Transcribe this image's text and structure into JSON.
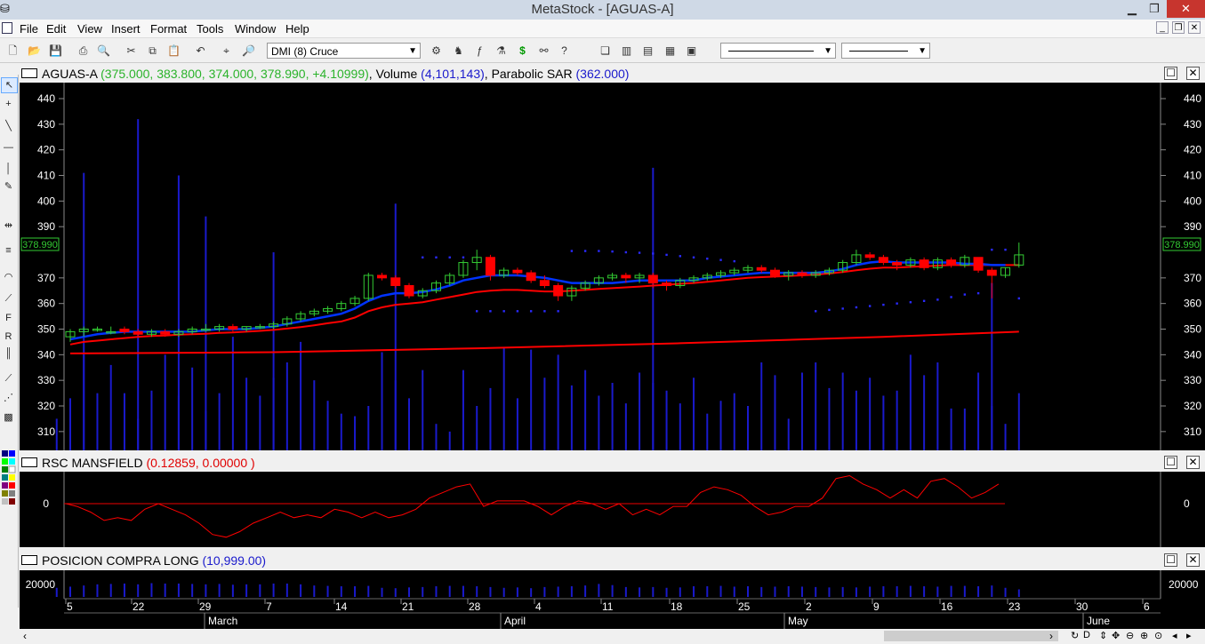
{
  "window": {
    "title": "MetaStock - [AGUAS-A]"
  },
  "menu": [
    "File",
    "Edit",
    "View",
    "Insert",
    "Format",
    "Tools",
    "Window",
    "Help"
  ],
  "toolbar": {
    "template_combo": "DMI (8) Cruce"
  },
  "price_panel": {
    "symbol": "AGUAS-A",
    "ohlc_text": "(375.000, 383.800, 374.000, 378.990, +4.10999)",
    "volume_label": "Volume",
    "volume_text": "(4,101,143)",
    "sar_label": "Parabolic SAR",
    "sar_text": "(362.000)",
    "last_price": "378.990",
    "y_ticks": [
      "440",
      "430",
      "420",
      "410",
      "400",
      "390",
      "370",
      "360",
      "350",
      "340",
      "330",
      "320",
      "310"
    ]
  },
  "rsc_panel": {
    "title": "RSC MANSFIELD",
    "values": "(0.12859, 0.00000 )",
    "y_tick": "0"
  },
  "pos_panel": {
    "title": "POSICION COMPRA LONG",
    "values": "(10,999.00)",
    "y_tick": "20000"
  },
  "x_axis": {
    "day_labels": [
      "5",
      "22",
      "29",
      "7",
      "14",
      "21",
      "28",
      "4",
      "11",
      "18",
      "25",
      "2",
      "9",
      "16",
      "23",
      "30",
      "6"
    ],
    "month_labels": [
      "March",
      "April",
      "May",
      "June"
    ]
  },
  "colors": {
    "up": "#33cc33",
    "down": "#ff0000",
    "ma_fast": "#0033ff",
    "ma_slow": "#ff0000",
    "volume": "#1a1acc",
    "sar": "#2a2aff",
    "label_green": "#2bb32b",
    "label_blue": "#1a1acc",
    "label_red": "#e00000"
  },
  "chart_data": {
    "type": "candlestick",
    "ylim": [
      305,
      445
    ],
    "candles": [
      [
        347,
        350,
        345,
        349
      ],
      [
        349,
        351,
        347,
        350
      ],
      [
        350,
        351,
        349,
        350
      ],
      [
        349,
        351,
        348,
        349
      ],
      [
        350,
        351,
        348,
        349
      ],
      [
        349,
        350,
        347,
        348
      ],
      [
        348,
        350,
        347,
        349
      ],
      [
        349,
        350,
        347,
        348
      ],
      [
        348,
        350,
        347,
        349
      ],
      [
        349,
        351,
        348,
        350
      ],
      [
        350,
        352,
        349,
        350
      ],
      [
        350,
        352,
        349,
        351
      ],
      [
        351,
        352,
        349,
        350
      ],
      [
        350,
        351,
        349,
        351
      ],
      [
        351,
        352,
        350,
        351
      ],
      [
        351,
        353,
        350,
        352
      ],
      [
        352,
        355,
        351,
        354
      ],
      [
        354,
        357,
        353,
        356
      ],
      [
        356,
        358,
        355,
        357
      ],
      [
        357,
        359,
        356,
        358
      ],
      [
        358,
        361,
        357,
        360
      ],
      [
        360,
        363,
        359,
        362
      ],
      [
        362,
        372,
        361,
        371
      ],
      [
        371,
        372,
        369,
        370
      ],
      [
        370,
        371,
        366,
        367
      ],
      [
        367,
        368,
        362,
        363
      ],
      [
        363,
        366,
        362,
        365
      ],
      [
        365,
        369,
        364,
        368
      ],
      [
        368,
        372,
        367,
        371
      ],
      [
        371,
        377,
        370,
        376
      ],
      [
        376,
        381,
        373,
        378
      ],
      [
        378,
        379,
        369,
        371
      ],
      [
        371,
        374,
        370,
        373
      ],
      [
        373,
        374,
        371,
        372
      ],
      [
        372,
        373,
        368,
        369
      ],
      [
        369,
        371,
        366,
        367
      ],
      [
        367,
        368,
        361,
        363
      ],
      [
        363,
        367,
        361,
        366
      ],
      [
        366,
        369,
        365,
        368
      ],
      [
        368,
        371,
        367,
        370
      ],
      [
        370,
        372,
        369,
        371
      ],
      [
        371,
        372,
        368,
        370
      ],
      [
        370,
        372,
        368,
        371
      ],
      [
        371,
        372,
        366,
        368
      ],
      [
        368,
        369,
        365,
        367
      ],
      [
        367,
        370,
        366,
        369
      ],
      [
        369,
        371,
        368,
        370
      ],
      [
        370,
        372,
        369,
        371
      ],
      [
        371,
        373,
        370,
        372
      ],
      [
        372,
        374,
        371,
        373
      ],
      [
        373,
        375,
        372,
        374
      ],
      [
        374,
        375,
        372,
        373
      ],
      [
        373,
        374,
        370,
        371
      ],
      [
        371,
        373,
        369,
        372
      ],
      [
        372,
        373,
        370,
        371
      ],
      [
        371,
        373,
        370,
        372
      ],
      [
        372,
        374,
        371,
        373
      ],
      [
        373,
        377,
        372,
        376
      ],
      [
        376,
        381,
        375,
        379
      ],
      [
        379,
        380,
        377,
        378
      ],
      [
        378,
        379,
        375,
        376
      ],
      [
        376,
        377,
        373,
        375
      ],
      [
        375,
        378,
        374,
        377
      ],
      [
        377,
        378,
        373,
        374
      ],
      [
        374,
        378,
        373,
        377
      ],
      [
        377,
        378,
        374,
        375
      ],
      [
        375,
        379,
        374,
        378
      ],
      [
        378,
        378,
        372,
        373
      ],
      [
        373,
        374,
        362,
        371
      ],
      [
        371,
        374,
        370,
        374
      ],
      [
        375,
        383.8,
        374,
        378.99
      ]
    ],
    "volume": [
      [
        -1,
        315
      ],
      [
        0,
        323
      ],
      [
        1,
        341
      ],
      [
        2,
        325
      ],
      [
        3,
        336
      ],
      [
        4,
        325
      ],
      [
        5,
        315
      ],
      [
        6,
        326
      ],
      [
        7,
        340
      ],
      [
        8,
        324
      ],
      [
        9,
        335
      ],
      [
        10,
        318
      ],
      [
        11,
        325
      ],
      [
        12,
        347
      ],
      [
        13,
        331
      ],
      [
        14,
        324
      ],
      [
        15,
        331
      ],
      [
        16,
        337
      ],
      [
        17,
        345
      ],
      [
        18,
        330
      ],
      [
        19,
        322
      ],
      [
        20,
        317
      ],
      [
        21,
        316
      ],
      [
        22,
        320
      ],
      [
        23,
        341
      ],
      [
        24,
        330
      ],
      [
        25,
        323
      ],
      [
        26,
        334
      ],
      [
        27,
        313
      ],
      [
        28,
        310
      ],
      [
        29,
        334
      ],
      [
        30,
        320
      ],
      [
        31,
        327
      ],
      [
        32,
        343
      ],
      [
        33,
        323
      ],
      [
        34,
        342
      ],
      [
        35,
        331
      ],
      [
        36,
        340
      ],
      [
        37,
        328
      ],
      [
        38,
        334
      ],
      [
        39,
        324
      ],
      [
        40,
        329
      ],
      [
        41,
        321
      ],
      [
        42,
        333
      ],
      [
        43,
        329
      ],
      [
        44,
        326
      ],
      [
        45,
        321
      ],
      [
        46,
        331
      ],
      [
        47,
        317
      ],
      [
        48,
        322
      ],
      [
        49,
        325
      ],
      [
        50,
        320
      ],
      [
        51,
        337
      ],
      [
        52,
        332
      ],
      [
        53,
        315
      ],
      [
        54,
        333
      ],
      [
        55,
        337
      ],
      [
        56,
        327
      ],
      [
        57,
        333
      ],
      [
        58,
        326
      ],
      [
        59,
        331
      ],
      [
        60,
        324
      ],
      [
        61,
        326
      ],
      [
        62,
        340
      ],
      [
        63,
        332
      ],
      [
        64,
        337
      ],
      [
        65,
        319
      ],
      [
        66,
        319
      ],
      [
        67,
        333
      ],
      [
        68,
        320
      ],
      [
        69,
        313
      ],
      [
        70,
        325
      ]
    ],
    "volume_spikes": [
      [
        1,
        411
      ],
      [
        5,
        432
      ],
      [
        8,
        410
      ],
      [
        10,
        394
      ],
      [
        15,
        380
      ],
      [
        24,
        399
      ],
      [
        43,
        413
      ],
      [
        68,
        368
      ]
    ],
    "ma_fast": [
      346,
      347,
      348,
      348.5,
      349,
      349,
      349,
      349,
      349,
      349,
      349.5,
      350,
      350,
      350,
      350.5,
      351,
      352,
      353,
      354,
      355,
      356,
      358,
      361,
      363,
      364,
      364,
      364.5,
      365.5,
      367,
      369,
      370,
      371,
      371,
      371,
      370.5,
      370,
      369,
      368,
      368,
      368,
      368,
      368.5,
      369,
      369,
      369,
      369,
      369,
      370,
      370.5,
      371,
      371.5,
      372,
      372,
      372,
      372,
      372,
      372.5,
      373.5,
      375,
      376,
      376.5,
      376,
      376,
      376,
      376,
      376,
      375.5,
      375.5,
      375,
      375
    ],
    "ma_mid": [
      344,
      345,
      345.5,
      346,
      346.5,
      347,
      347.3,
      347.5,
      347.8,
      348,
      348.2,
      348.5,
      348.7,
      349,
      349.3,
      349.7,
      350.2,
      350.8,
      351.5,
      352.3,
      353,
      354.5,
      357,
      358.5,
      359.5,
      360,
      360.5,
      361.5,
      362.5,
      363.5,
      364.5,
      365,
      365.3,
      365.3,
      365,
      364.7,
      364.7,
      365,
      365.3,
      365.7,
      366,
      366.3,
      366.6,
      367,
      367.3,
      367.7,
      368,
      368.5,
      369,
      369.5,
      370,
      370.3,
      370.5,
      370.7,
      371,
      371.3,
      371.7,
      372.3,
      373,
      373.6,
      374,
      374,
      374.3,
      374.5,
      374.8,
      375,
      375,
      375,
      375,
      375,
      375
    ],
    "ma_slow": [
      [
        0,
        340.5
      ],
      [
        15,
        341
      ],
      [
        30,
        342.5
      ],
      [
        45,
        344.5
      ],
      [
        60,
        347
      ],
      [
        70,
        349
      ]
    ],
    "sar": [
      [
        26,
        378
      ],
      [
        27,
        378
      ],
      [
        28,
        378
      ],
      [
        29,
        378
      ],
      [
        30,
        357
      ],
      [
        31,
        357
      ],
      [
        32,
        357
      ],
      [
        33,
        357
      ],
      [
        34,
        357
      ],
      [
        35,
        357
      ],
      [
        36,
        357
      ],
      [
        37,
        380.5
      ],
      [
        38,
        380.5
      ],
      [
        39,
        380.5
      ],
      [
        40,
        380.3
      ],
      [
        41,
        380
      ],
      [
        42,
        379.8
      ],
      [
        43,
        379.5
      ],
      [
        44,
        379
      ],
      [
        45,
        378.5
      ],
      [
        46,
        378
      ],
      [
        47,
        377.5
      ],
      [
        48,
        377
      ],
      [
        49,
        376.5
      ],
      [
        55,
        357
      ],
      [
        56,
        357.5
      ],
      [
        57,
        358
      ],
      [
        58,
        358.5
      ],
      [
        59,
        359
      ],
      [
        60,
        359.5
      ],
      [
        61,
        360
      ],
      [
        62,
        360.5
      ],
      [
        63,
        361
      ],
      [
        64,
        361.5
      ],
      [
        65,
        362.5
      ],
      [
        66,
        363.5
      ],
      [
        67,
        364
      ],
      [
        68,
        381
      ],
      [
        69,
        381
      ],
      [
        70,
        362
      ]
    ],
    "rsc": [
      [
        -0.3,
        0
      ],
      [
        0.5,
        -0.5
      ],
      [
        1.5,
        -1.5
      ],
      [
        2.5,
        -3
      ],
      [
        3.5,
        -2.5
      ],
      [
        4.5,
        -3
      ],
      [
        5.5,
        -1
      ],
      [
        6.5,
        0
      ],
      [
        7.5,
        -1
      ],
      [
        8.5,
        -2
      ],
      [
        9.5,
        -3.5
      ],
      [
        10.5,
        -5.5
      ],
      [
        11.5,
        -6
      ],
      [
        12.5,
        -5
      ],
      [
        13.5,
        -3.5
      ],
      [
        14.5,
        -2.5
      ],
      [
        15.5,
        -1.5
      ],
      [
        16.5,
        -2.5
      ],
      [
        17.5,
        -2
      ],
      [
        18.5,
        -2.5
      ],
      [
        19.5,
        -1
      ],
      [
        20.5,
        -1.5
      ],
      [
        21.5,
        -2.5
      ],
      [
        22.5,
        -1.5
      ],
      [
        23.5,
        -2.5
      ],
      [
        24.5,
        -2
      ],
      [
        25.5,
        -1
      ],
      [
        26.5,
        1
      ],
      [
        27.5,
        2
      ],
      [
        28.5,
        3
      ],
      [
        29.5,
        3.5
      ],
      [
        30.5,
        -0.5
      ],
      [
        31.5,
        0.5
      ],
      [
        32.5,
        0.5
      ],
      [
        33.5,
        0.5
      ],
      [
        34.5,
        -0.5
      ],
      [
        35.5,
        -2
      ],
      [
        36.5,
        -0.5
      ],
      [
        37.5,
        0.5
      ],
      [
        38.5,
        0
      ],
      [
        39.5,
        -1
      ],
      [
        40.5,
        0
      ],
      [
        41.5,
        -2
      ],
      [
        42.5,
        -1
      ],
      [
        43.5,
        -2
      ],
      [
        44.5,
        -0.5
      ],
      [
        45.5,
        -0.5
      ],
      [
        46.5,
        2
      ],
      [
        47.5,
        3
      ],
      [
        48.5,
        2.5
      ],
      [
        49.5,
        1.5
      ],
      [
        50.5,
        -0.5
      ],
      [
        51.5,
        -2
      ],
      [
        52.5,
        -1.5
      ],
      [
        53.5,
        -0.5
      ],
      [
        54.5,
        -0.5
      ],
      [
        55.5,
        1
      ],
      [
        56.5,
        4.5
      ],
      [
        57.5,
        5
      ],
      [
        58.5,
        3.5
      ],
      [
        59.5,
        2.5
      ],
      [
        60.5,
        1
      ],
      [
        61.5,
        2.5
      ],
      [
        62.5,
        1
      ],
      [
        63.5,
        4
      ],
      [
        64.5,
        4.5
      ],
      [
        65.5,
        3
      ],
      [
        66.5,
        1
      ],
      [
        67.5,
        2
      ],
      [
        68.5,
        3.5
      ]
    ],
    "pos_bars": [
      [
        -1,
        14000
      ],
      [
        0,
        15500
      ],
      [
        1,
        17000
      ],
      [
        2,
        18500
      ],
      [
        3,
        19000
      ],
      [
        4,
        19500
      ],
      [
        5,
        18500
      ],
      [
        6,
        20000
      ],
      [
        7,
        19500
      ],
      [
        8,
        19500
      ],
      [
        9,
        19000
      ],
      [
        10,
        18500
      ],
      [
        11,
        19000
      ],
      [
        12,
        18000
      ],
      [
        13,
        18500
      ],
      [
        14,
        18500
      ],
      [
        15,
        19500
      ],
      [
        16,
        19500
      ],
      [
        17,
        18500
      ],
      [
        18,
        17000
      ],
      [
        19,
        16500
      ],
      [
        20,
        16000
      ],
      [
        21,
        16000
      ],
      [
        22,
        16500
      ],
      [
        23,
        14000
      ],
      [
        24,
        13500
      ],
      [
        25,
        14500
      ],
      [
        26,
        15000
      ],
      [
        27,
        16000
      ],
      [
        28,
        16500
      ],
      [
        29,
        16500
      ],
      [
        30,
        16000
      ],
      [
        31,
        15000
      ],
      [
        32,
        14000
      ],
      [
        33,
        14500
      ],
      [
        34,
        13500
      ],
      [
        35,
        15000
      ],
      [
        36,
        15500
      ],
      [
        37,
        16000
      ],
      [
        38,
        17000
      ],
      [
        39,
        19000
      ],
      [
        40,
        17500
      ],
      [
        41,
        15000
      ],
      [
        42,
        14500
      ],
      [
        43,
        15000
      ],
      [
        44,
        14000
      ],
      [
        45,
        14500
      ],
      [
        46,
        16000
      ],
      [
        47,
        16000
      ],
      [
        48,
        16500
      ],
      [
        49,
        15500
      ],
      [
        50,
        16000
      ],
      [
        51,
        15000
      ],
      [
        52,
        15500
      ],
      [
        53,
        16000
      ],
      [
        54,
        15500
      ],
      [
        55,
        15000
      ],
      [
        56,
        14500
      ],
      [
        57,
        15000
      ],
      [
        58,
        14500
      ],
      [
        59,
        15500
      ],
      [
        60,
        16000
      ],
      [
        61,
        16000
      ],
      [
        62,
        16500
      ],
      [
        63,
        16000
      ],
      [
        64,
        15500
      ],
      [
        65,
        16500
      ],
      [
        66,
        16500
      ],
      [
        67,
        16000
      ],
      [
        68,
        17000
      ],
      [
        69,
        14000
      ],
      [
        70,
        12000
      ]
    ]
  }
}
